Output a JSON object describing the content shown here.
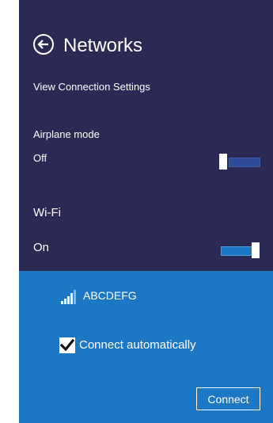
{
  "header": {
    "title": "Networks",
    "back_icon": "back-arrow-circle-icon"
  },
  "settings_link": "View Connection Settings",
  "airplane_mode": {
    "label": "Airplane mode",
    "state": "Off",
    "is_on": false
  },
  "wifi": {
    "label": "Wi-Fi",
    "state": "On",
    "is_on": true
  },
  "network": {
    "name": "ABCDEFG",
    "signal_icon": "wifi-signal-bars-icon",
    "signal_bars_filled": 4,
    "signal_bars_total": 5,
    "connect_automatically_label": "Connect automatically",
    "connect_automatically_checked": true,
    "connect_button": "Connect"
  },
  "colors": {
    "panel_dark": "#2b2a55",
    "panel_accent": "#1c78c5",
    "text": "#ffffff"
  }
}
